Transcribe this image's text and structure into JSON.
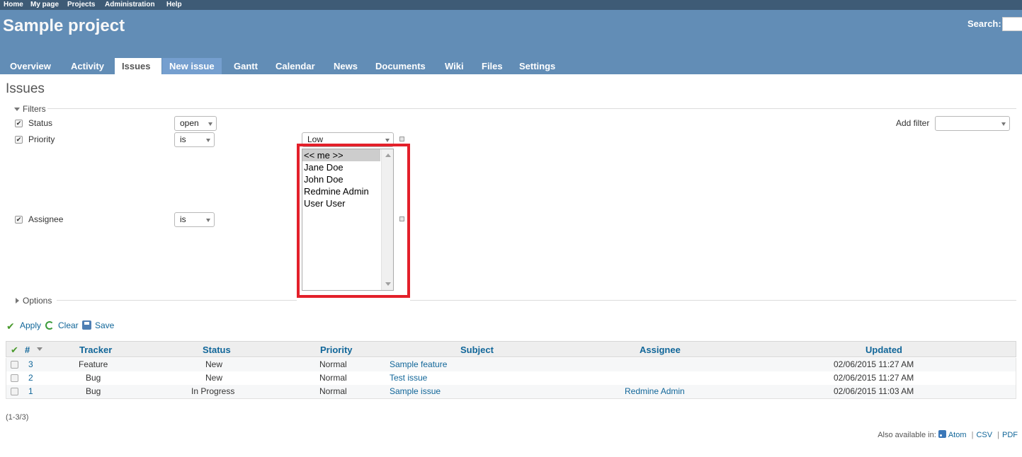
{
  "top_menu": [
    "Home",
    "My page",
    "Projects",
    "Administration",
    "Help"
  ],
  "header": {
    "project_title": "Sample project",
    "search_label": "Search:"
  },
  "tabs": [
    "Overview",
    "Activity",
    "Issues",
    "New issue",
    "Gantt",
    "Calendar",
    "News",
    "Documents",
    "Wiki",
    "Files",
    "Settings"
  ],
  "selected_tab": "Issues",
  "page_title": "Issues",
  "filters": {
    "legend": "Filters",
    "status": {
      "label": "Status",
      "operator": "open",
      "checked": true
    },
    "priority": {
      "label": "Priority",
      "operator": "is",
      "value": "Low",
      "checked": true
    },
    "assignee": {
      "label": "Assignee",
      "operator": "is",
      "checked": true,
      "options": [
        "<< me >>",
        "Jane Doe",
        "John Doe",
        "Redmine Admin",
        "User User"
      ],
      "selected": "<< me >>"
    },
    "add_filter_label": "Add filter",
    "add_filter_value": ""
  },
  "options_legend": "Options",
  "actions": {
    "apply": "Apply",
    "clear": "Clear",
    "save": "Save"
  },
  "table": {
    "headers": {
      "num": "#",
      "tracker": "Tracker",
      "status": "Status",
      "priority": "Priority",
      "subject": "Subject",
      "assignee": "Assignee",
      "updated": "Updated"
    },
    "rows": [
      {
        "id": "3",
        "tracker": "Feature",
        "status": "New",
        "priority": "Normal",
        "subject": "Sample feature",
        "assignee": "",
        "updated": "02/06/2015 11:27 AM"
      },
      {
        "id": "2",
        "tracker": "Bug",
        "status": "New",
        "priority": "Normal",
        "subject": "Test issue",
        "assignee": "",
        "updated": "02/06/2015 11:27 AM"
      },
      {
        "id": "1",
        "tracker": "Bug",
        "status": "In Progress",
        "priority": "Normal",
        "subject": "Sample issue",
        "assignee": "Redmine Admin",
        "updated": "02/06/2015 11:03 AM"
      }
    ]
  },
  "pagination": "(1-3/3)",
  "other_formats": {
    "label": "Also available in:",
    "atom": "Atom",
    "csv": "CSV",
    "pdf": "PDF"
  },
  "colors": {
    "top_menu_bg": "#3E5B76",
    "header_bg": "#628DB6",
    "link": "#116699",
    "highlight_border": "#E3202A"
  }
}
